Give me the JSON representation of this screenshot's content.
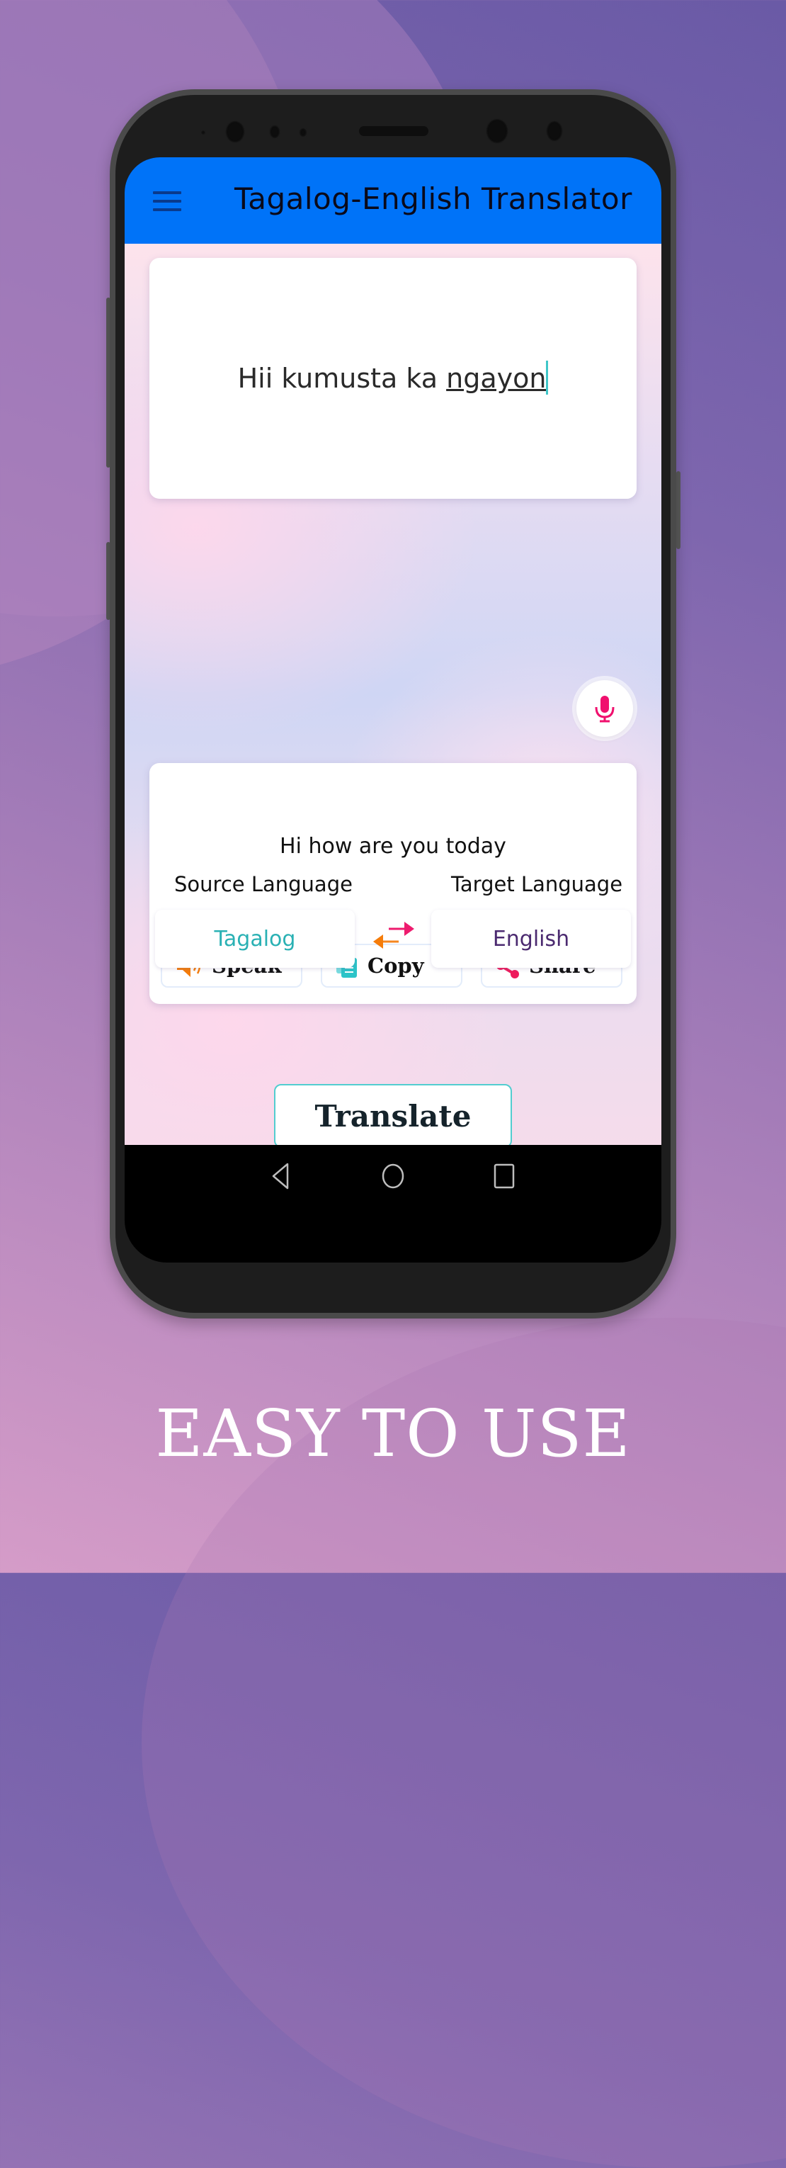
{
  "app": {
    "title": "Tagalog-English Translator",
    "accent_color": "#0073f8"
  },
  "input": {
    "text_plain": "Hii kumusta ka ",
    "text_underlined": "ngayon"
  },
  "output": {
    "text": "Hi how are you today"
  },
  "actions": {
    "speak_label": "Speak",
    "copy_label": "Copy",
    "share_label": "Share"
  },
  "languages": {
    "source_label": "Source Language",
    "target_label": "Target Language",
    "source_value": "Tagalog",
    "target_value": "English"
  },
  "translate_label": "Translate",
  "tagline": "EASY TO USE",
  "icons": {
    "menu": "hamburger-menu-icon",
    "mic": "microphone-icon",
    "speak": "speaker-icon",
    "copy": "copy-icon",
    "share": "share-icon",
    "swap": "swap-arrows-icon",
    "nav_back": "back-triangle-icon",
    "nav_home": "home-circle-icon",
    "nav_recent": "recent-square-icon"
  }
}
